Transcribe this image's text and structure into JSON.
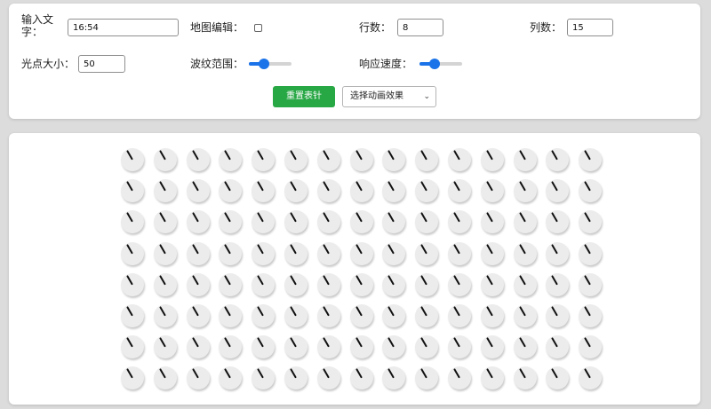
{
  "controls": {
    "text_label": "输入文\n字：",
    "text_value": "16:54",
    "map_edit_label": "地图编辑：",
    "map_edit_checked": false,
    "rows_label": "行数：",
    "rows_value": "8",
    "cols_label": "列数：",
    "cols_value": "15",
    "dot_size_label": "光点大小：",
    "dot_size_value": "50",
    "ripple_label": "波纹范围：",
    "ripple_level": 0.35,
    "speed_label": "响应速度：",
    "speed_level": 0.35,
    "reset_button": "重置表针",
    "effect_select": "选择动画效果"
  },
  "grid": {
    "rows": 8,
    "cols": 15,
    "hand_angle_deg": -30
  },
  "colors": {
    "accent": "#1a73e8",
    "reset_button": "#28a745",
    "clock_face": "#ececec",
    "hand": "#111111"
  }
}
